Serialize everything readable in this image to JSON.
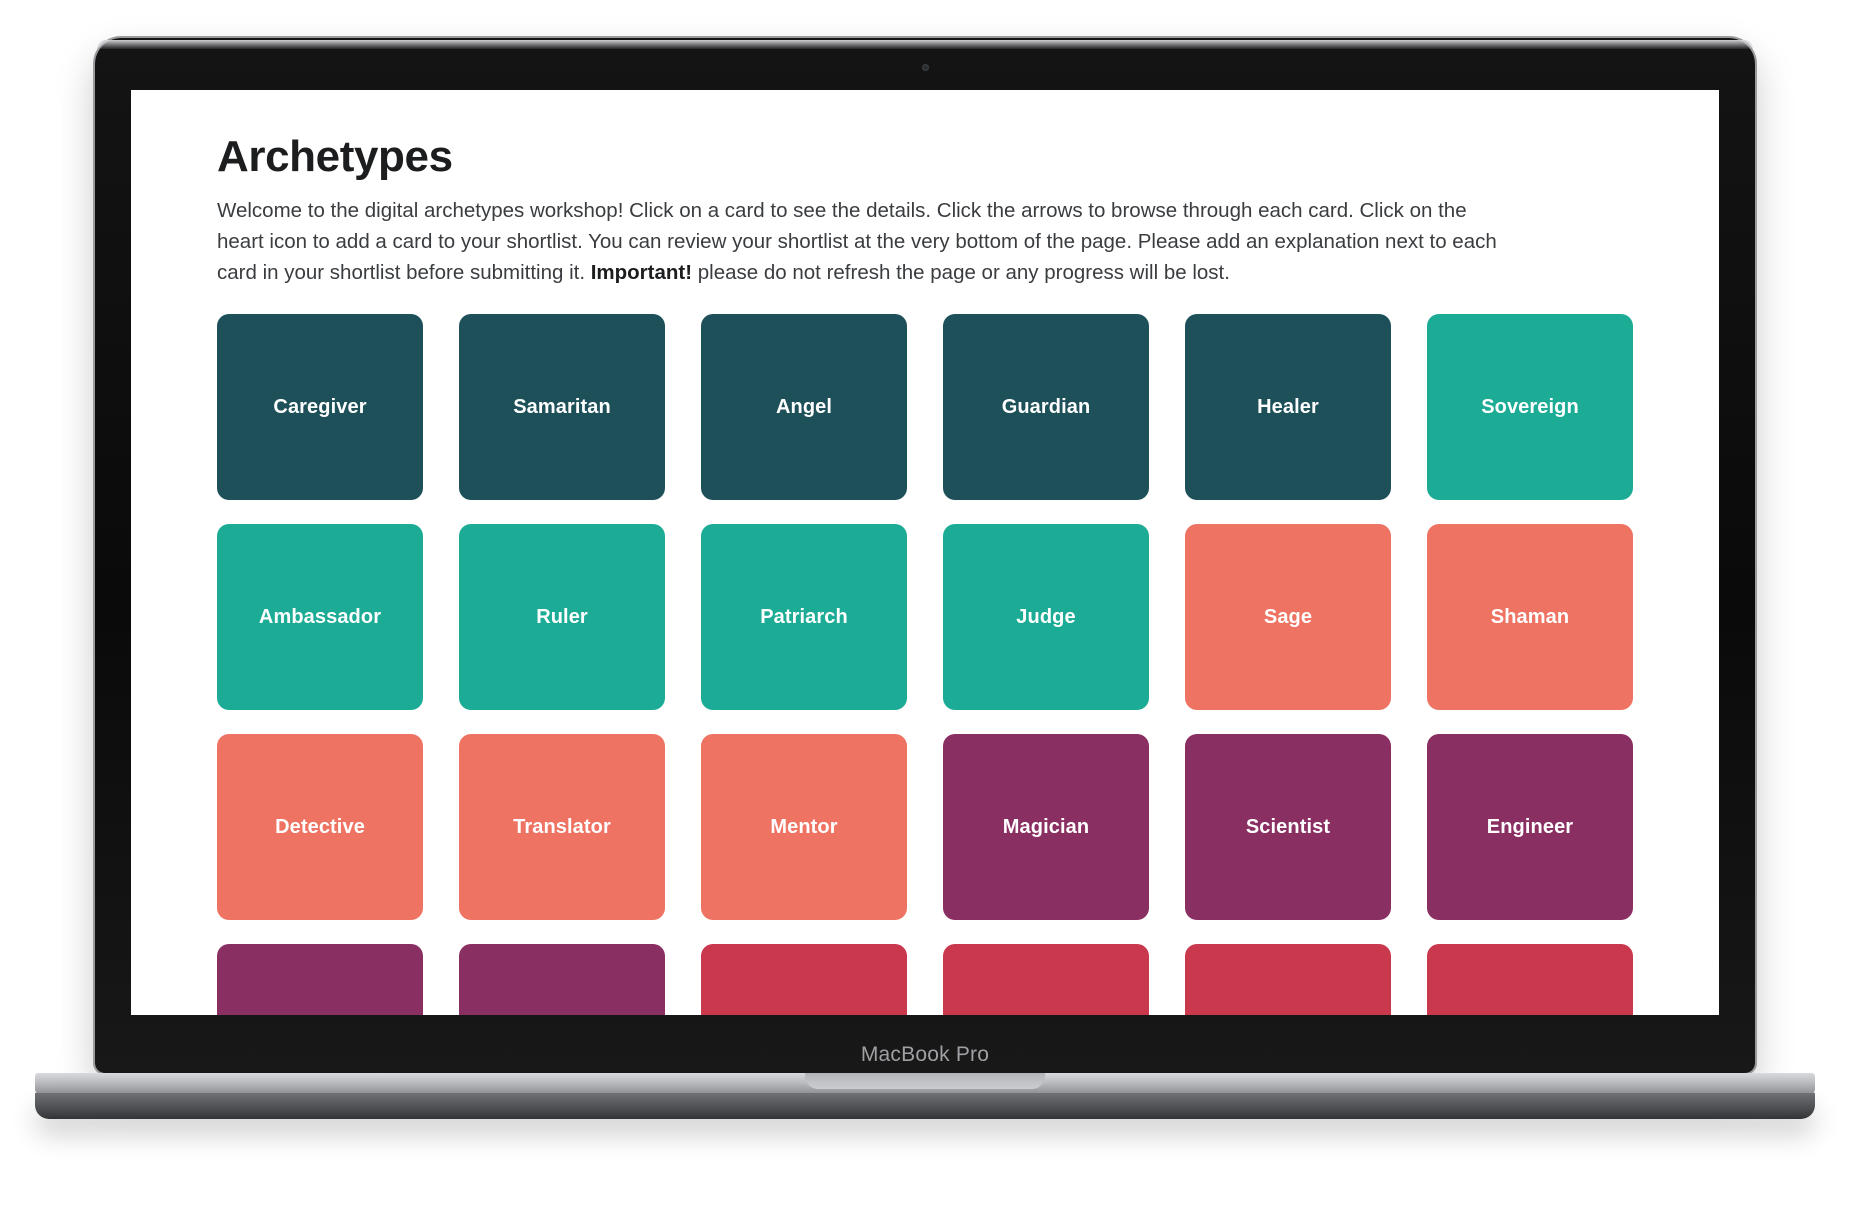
{
  "device": {
    "brand_label": "MacBook Pro"
  },
  "page": {
    "title": "Archetypes",
    "intro": {
      "part1": "Welcome to the digital archetypes workshop! Click on a card to see the details. Click the arrows to browse through each card. Click on the heart icon to add a card to your shortlist. You can review your shortlist at the very bottom of the page. Please add an explanation next to each card in your shortlist before submitting it. ",
      "emphasis": "Important!",
      "part2": " please do not refresh the page or any progress will be lost."
    }
  },
  "colors": {
    "dark_teal": "#1d5059",
    "green": "#1cab95",
    "salmon": "#ee7362",
    "purple": "#8a2f61",
    "crimson": "#c9384c",
    "card_text": "#ffffff",
    "heading": "#1b1d1f"
  },
  "cards": [
    {
      "label": "Caregiver",
      "color": "#1d5059"
    },
    {
      "label": "Samaritan",
      "color": "#1d5059"
    },
    {
      "label": "Angel",
      "color": "#1d5059"
    },
    {
      "label": "Guardian",
      "color": "#1d5059"
    },
    {
      "label": "Healer",
      "color": "#1d5059"
    },
    {
      "label": "Sovereign",
      "color": "#1cab95"
    },
    {
      "label": "Ambassador",
      "color": "#1cab95"
    },
    {
      "label": "Ruler",
      "color": "#1cab95"
    },
    {
      "label": "Patriarch",
      "color": "#1cab95"
    },
    {
      "label": "Judge",
      "color": "#1cab95"
    },
    {
      "label": "Sage",
      "color": "#ee7362"
    },
    {
      "label": "Shaman",
      "color": "#ee7362"
    },
    {
      "label": "Detective",
      "color": "#ee7362"
    },
    {
      "label": "Translator",
      "color": "#ee7362"
    },
    {
      "label": "Mentor",
      "color": "#ee7362"
    },
    {
      "label": "Magician",
      "color": "#8a2f61"
    },
    {
      "label": "Scientist",
      "color": "#8a2f61"
    },
    {
      "label": "Engineer",
      "color": "#8a2f61"
    },
    {
      "label": "",
      "color": "#8a2f61"
    },
    {
      "label": "",
      "color": "#8a2f61"
    },
    {
      "label": "",
      "color": "#c9384c"
    },
    {
      "label": "",
      "color": "#c9384c"
    },
    {
      "label": "",
      "color": "#c9384c"
    },
    {
      "label": "",
      "color": "#c9384c"
    }
  ]
}
